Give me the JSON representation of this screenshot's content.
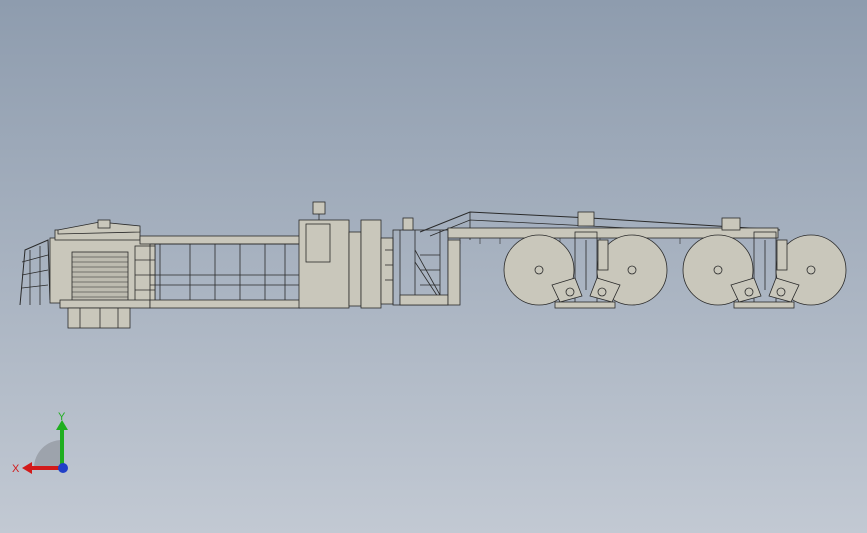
{
  "view": {
    "background_top": "#8e9cae",
    "background_bottom": "#c2c9d3",
    "model_fill": "#c9c7bb",
    "model_stroke": "#2a2a2a"
  },
  "triad": {
    "x_label": "X",
    "y_label": "Y",
    "x_color": "#d21a1a",
    "y_color": "#1fae1f",
    "z_color": "#2140c8"
  }
}
